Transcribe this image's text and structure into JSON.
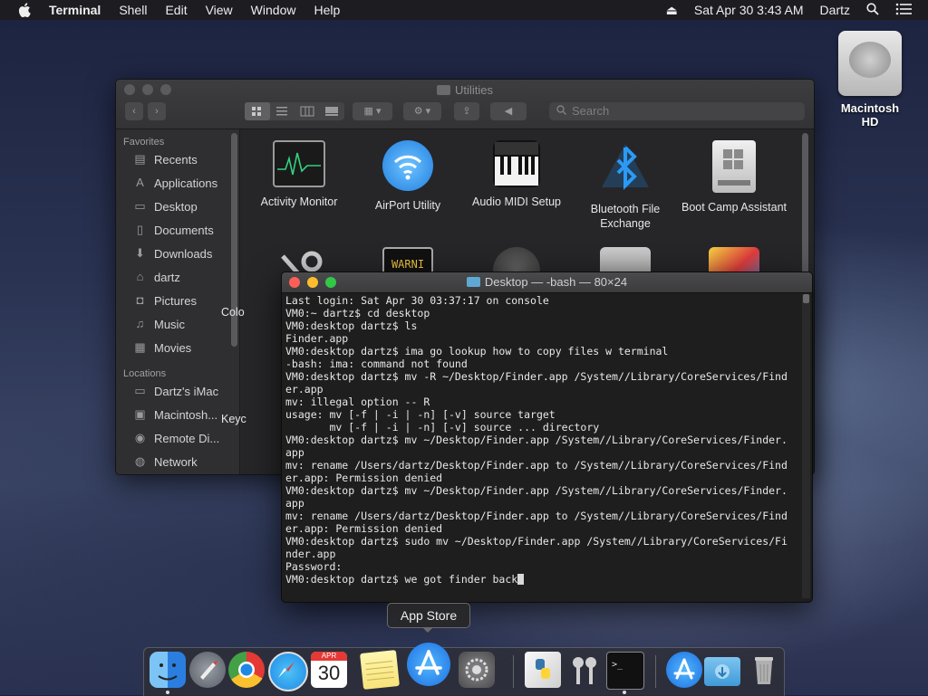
{
  "menubar": {
    "app_name": "Terminal",
    "items": [
      "Shell",
      "Edit",
      "View",
      "Window",
      "Help"
    ],
    "datetime": "Sat Apr 30  3:43 AM",
    "user": "Dartz",
    "icons": [
      "apple-icon",
      "eject-icon",
      "spotlight-icon",
      "notification-center-icon"
    ]
  },
  "desktop": {
    "hd_label": "Macintosh HD"
  },
  "finder": {
    "title": "Utilities",
    "search_placeholder": "Search",
    "sidebar": {
      "favorites_heading": "Favorites",
      "favorites": [
        "Recents",
        "Applications",
        "Desktop",
        "Documents",
        "Downloads",
        "dartz",
        "Pictures",
        "Music",
        "Movies"
      ],
      "locations_heading": "Locations",
      "locations": [
        "Dartz's iMac",
        "Macintosh...",
        "Remote Di...",
        "Network"
      ]
    },
    "apps": [
      {
        "label": "Activity Monitor",
        "icon": "activity-monitor-icon"
      },
      {
        "label": "AirPort Utility",
        "icon": "airport-utility-icon"
      },
      {
        "label": "Audio MIDI Setup",
        "icon": "audio-midi-icon"
      },
      {
        "label": "Bluetooth File Exchange",
        "icon": "bluetooth-icon"
      },
      {
        "label": "Boot Camp Assistant",
        "icon": "boot-camp-icon"
      }
    ],
    "partial_labels": {
      "colorsync": "Colo",
      "keychain": "Keyc"
    },
    "console_badge": "WARNI"
  },
  "terminal": {
    "title": "Desktop — -bash — 80×24",
    "lines": [
      "Last login: Sat Apr 30 03:37:17 on console",
      "VM0:~ dartz$ cd desktop",
      "VM0:desktop dartz$ ls",
      "Finder.app",
      "VM0:desktop dartz$ ima go lookup how to copy files w terminal",
      "-bash: ima: command not found",
      "VM0:desktop dartz$ mv -R ~/Desktop/Finder.app /System//Library/CoreServices/Find",
      "er.app",
      "mv: illegal option -- R",
      "usage: mv [-f | -i | -n] [-v] source target",
      "       mv [-f | -i | -n] [-v] source ... directory",
      "VM0:desktop dartz$ mv ~/Desktop/Finder.app /System//Library/CoreServices/Finder.",
      "app",
      "mv: rename /Users/dartz/Desktop/Finder.app to /System//Library/CoreServices/Find",
      "er.app: Permission denied",
      "VM0:desktop dartz$ mv ~/Desktop/Finder.app /System//Library/CoreServices/Finder.",
      "app",
      "mv: rename /Users/dartz/Desktop/Finder.app to /System//Library/CoreServices/Find",
      "er.app: Permission denied",
      "VM0:desktop dartz$ sudo mv ~/Desktop/Finder.app /System//Library/CoreServices/Fi",
      "nder.app",
      "Password:",
      "VM0:desktop dartz$ we got finder back"
    ]
  },
  "tooltip": {
    "text": "App Store"
  },
  "dock": {
    "items": [
      "finder-icon",
      "launchpad-icon",
      "chrome-icon",
      "safari-icon",
      "calendar-icon",
      "notes-icon",
      "app-store-icon",
      "system-preferences-icon",
      "python-launcher-icon",
      "keychain-access-icon",
      "terminal-icon",
      "app-store-folder-icon",
      "downloads-folder-icon",
      "trash-icon"
    ],
    "calendar_month": "APR",
    "calendar_day": "30",
    "colors": {
      "finder": "#2a7ee0",
      "chrome": "#e53935",
      "safari": "#1e88e5",
      "app_store": "#1d8af4"
    }
  }
}
